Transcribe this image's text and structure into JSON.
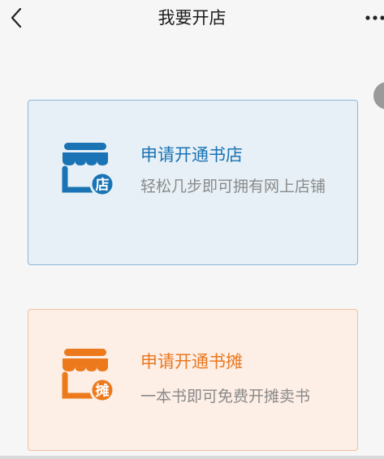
{
  "header": {
    "title": "我要开店"
  },
  "cards": [
    {
      "title": "申请开通书店",
      "description": "轻松几步即可拥有网上店铺",
      "badge": "店",
      "icon": "storefront-icon",
      "accent": "#1a73b4"
    },
    {
      "title": "申请开通书摊",
      "description": "一本书即可免费开摊卖书",
      "badge": "摊",
      "icon": "stall-icon",
      "accent": "#e9781f"
    }
  ],
  "colors": {
    "background": "#f6f6f6",
    "store_card_bg": "#e6f0f6",
    "store_card_border": "#8db7d8",
    "stall_card_bg": "#fdeee6",
    "stall_card_border": "#f2bf9c"
  }
}
